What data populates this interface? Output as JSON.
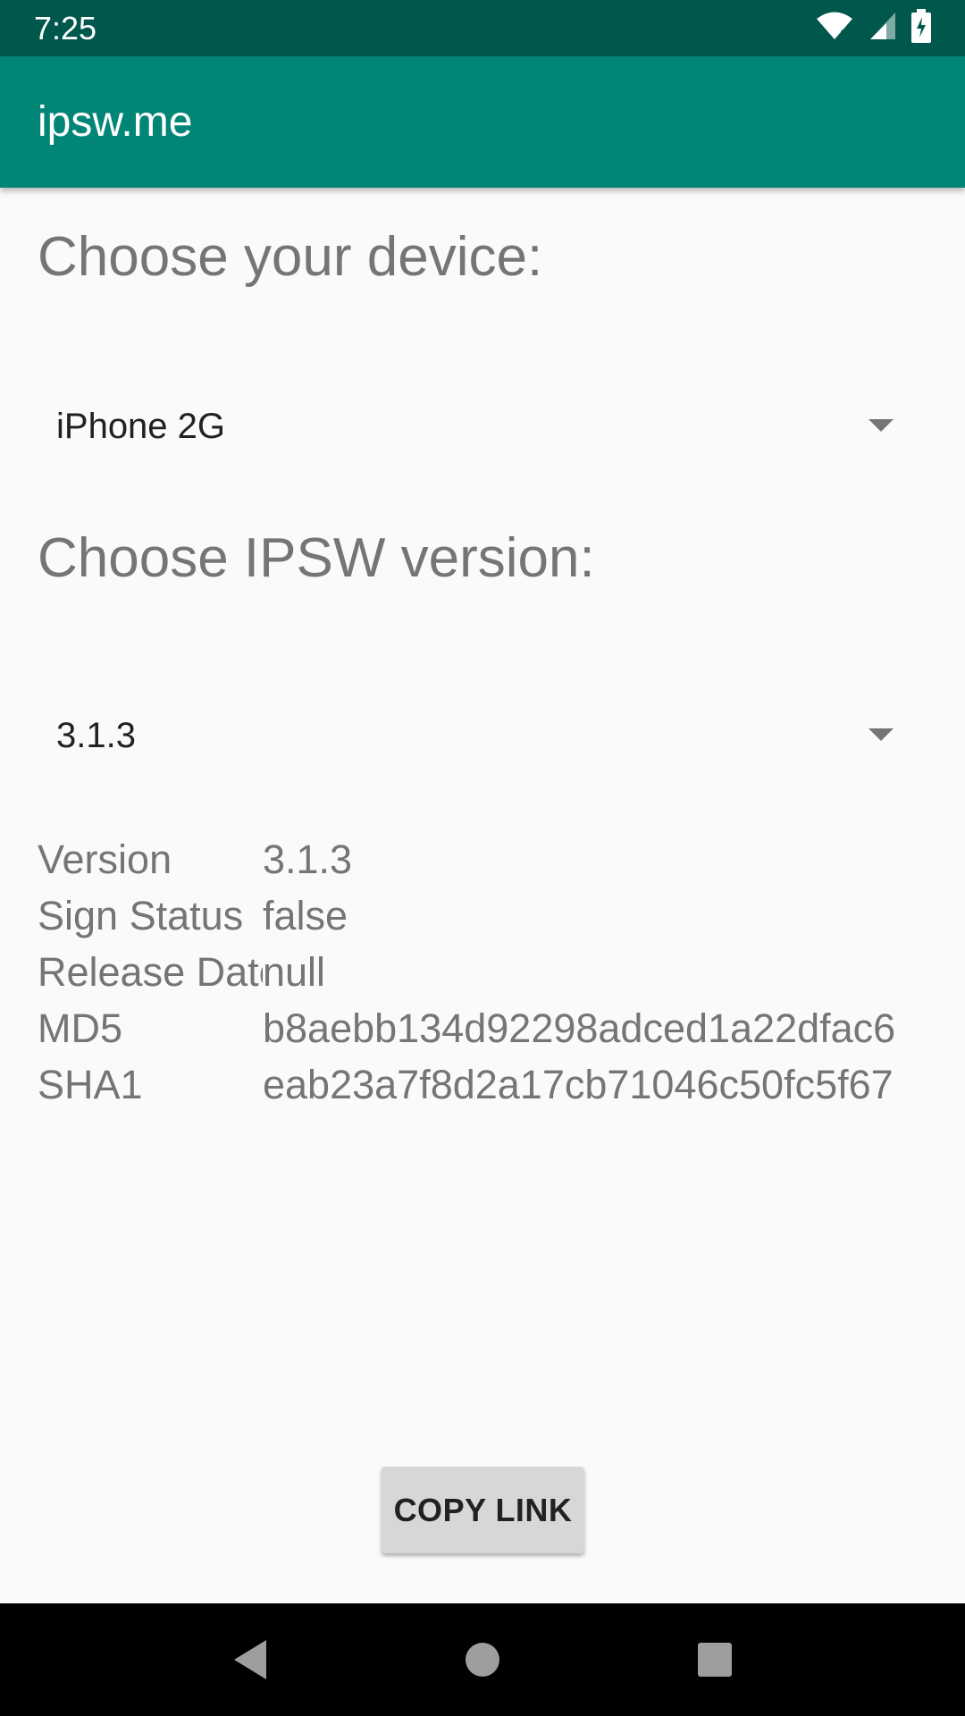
{
  "status_bar": {
    "time": "7:25",
    "icons": [
      "wifi-icon",
      "cellular-signal-icon",
      "battery-charging-icon"
    ]
  },
  "app_bar": {
    "title": "ipsw.me"
  },
  "device_section": {
    "heading": "Choose your device:",
    "selected_device": "iPhone 2G"
  },
  "version_section": {
    "heading": "Choose IPSW version:",
    "selected_version": "3.1.3"
  },
  "details": [
    {
      "label": "Version",
      "value": "3.1.3"
    },
    {
      "label": "Sign Status",
      "value": "false"
    },
    {
      "label": "Release Date",
      "value": "null"
    },
    {
      "label": "MD5",
      "value": "b8aebb134d92298adced1a22dfac6"
    },
    {
      "label": "SHA1",
      "value": "eab23a7f8d2a17cb71046c50fc5f67"
    }
  ],
  "actions": {
    "copy_link": "COPY LINK"
  },
  "nav_bar": {
    "buttons": [
      "back-icon",
      "home-icon",
      "recents-icon"
    ]
  },
  "colors": {
    "status_bar": "#00574b",
    "app_bar": "#008577",
    "background": "#fafafa",
    "heading_text": "#757575"
  }
}
